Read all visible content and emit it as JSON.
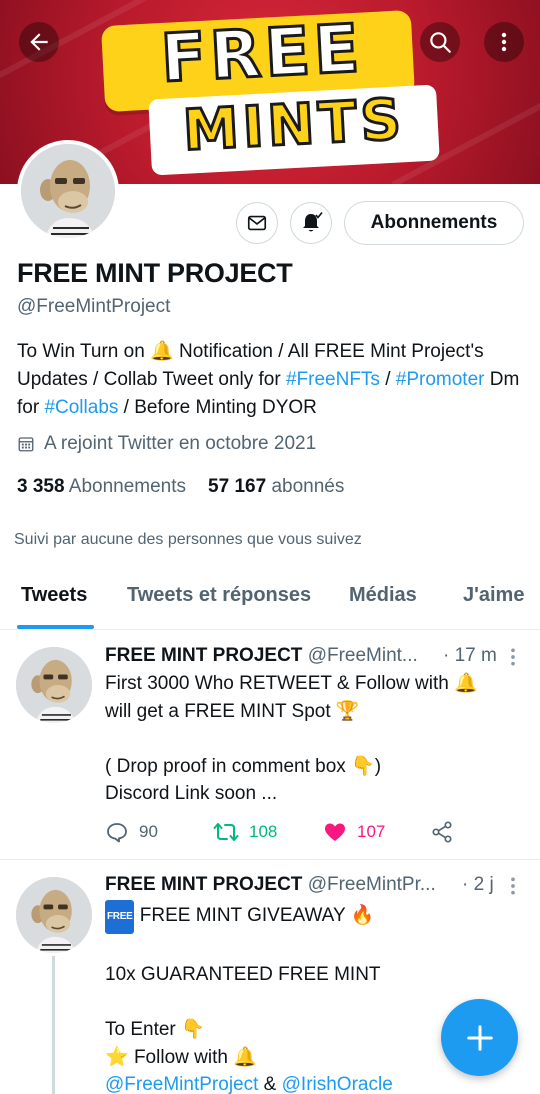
{
  "banner": {
    "line1": "FREE",
    "line2": "MINTS"
  },
  "profile": {
    "name": "FREE MINT PROJECT",
    "handle": "@FreeMintProject",
    "follow_label": "Abonnements",
    "bio": {
      "p1": "To Win Turn on ",
      "p2": " Notification / All FREE Mint Project's Updates / Collab Tweet only for ",
      "tag1": "#FreeNFTs",
      "p3": " / ",
      "tag2": "#Promoter",
      "p4": " Dm for ",
      "tag3": "#Collabs",
      "p5": " / Before Minting DYOR"
    },
    "joined": "A rejoint Twitter en octobre 2021",
    "following_count": "3 358",
    "following_label": "Abonnements",
    "followers_count": "57 167",
    "followers_label": "abonnés",
    "followed_by": "Suivi par aucune des personnes que vous suivez"
  },
  "tabs": [
    {
      "label": "Tweets",
      "active": true
    },
    {
      "label": "Tweets et réponses",
      "active": false
    },
    {
      "label": "Médias",
      "active": false
    },
    {
      "label": "J'aime",
      "active": false
    }
  ],
  "tweets": [
    {
      "name": "FREE MINT PROJECT",
      "handle": "@FreeMint...",
      "time": "· 17 m",
      "lines": {
        "l1a": "First 3000 Who RETWEET & Follow with ",
        "l2a": "will get a FREE MINT Spot ",
        "l4a": "( Drop proof in comment box ",
        "l4b": ")",
        "l5": "Discord Link soon ..."
      },
      "replies": "90",
      "retweets": "108",
      "likes": "107"
    },
    {
      "name": "FREE MINT PROJECT",
      "handle": "@FreeMintPr...",
      "time": "· 2 j",
      "lines": {
        "badge": "FREE",
        "l1": " FREE MINT GIVEAWAY ",
        "l3": "10x GUARANTEED FREE MINT",
        "l5": "To Enter ",
        "l6": " Follow with ",
        "m1": "@FreeMintProject",
        "amp": " & ",
        "m2": "@IrishOracle"
      }
    }
  ],
  "colors": {
    "accent": "#1d9bf0",
    "retweet": "#00ba7c",
    "like": "#f91880",
    "secondary_text": "#536471"
  }
}
